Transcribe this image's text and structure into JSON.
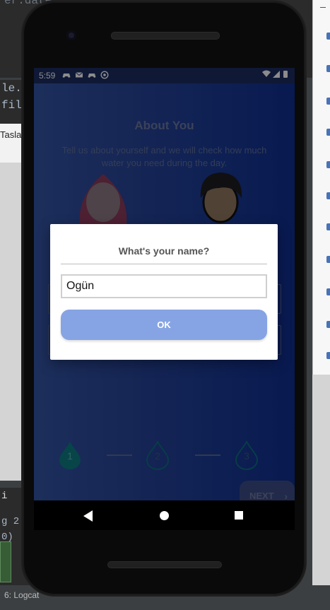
{
  "ide": {
    "code_fragment_top": "er.date",
    "code_line_1": "le.",
    "code_line_2": "file",
    "tab_label": "Tasla",
    "bottom_line_1": "g 2",
    "bottom_line_2": "0)",
    "status_tab": "6: Logcat",
    "left_glyph": "i"
  },
  "statusbar": {
    "time": "5:59",
    "icons": [
      "gamepad-icon",
      "mail-icon",
      "gamepad-icon",
      "at-icon"
    ],
    "right_icons": [
      "wifi-icon",
      "signal-icon",
      "battery-icon"
    ]
  },
  "app": {
    "title": "About You",
    "subtitle": "Tell us about yourself and we will check how much water you need during the day.",
    "steps": [
      "1",
      "2",
      "3"
    ],
    "next_label": "NEXT",
    "next_icon": "chevron-right-icon"
  },
  "dialog": {
    "title": "What's your name?",
    "name_value": "Ogün",
    "ok_label": "OK"
  },
  "colors": {
    "primary": "#86a4e4",
    "screen_bg": "#1b3b98",
    "step_active": "#00bcd4"
  }
}
